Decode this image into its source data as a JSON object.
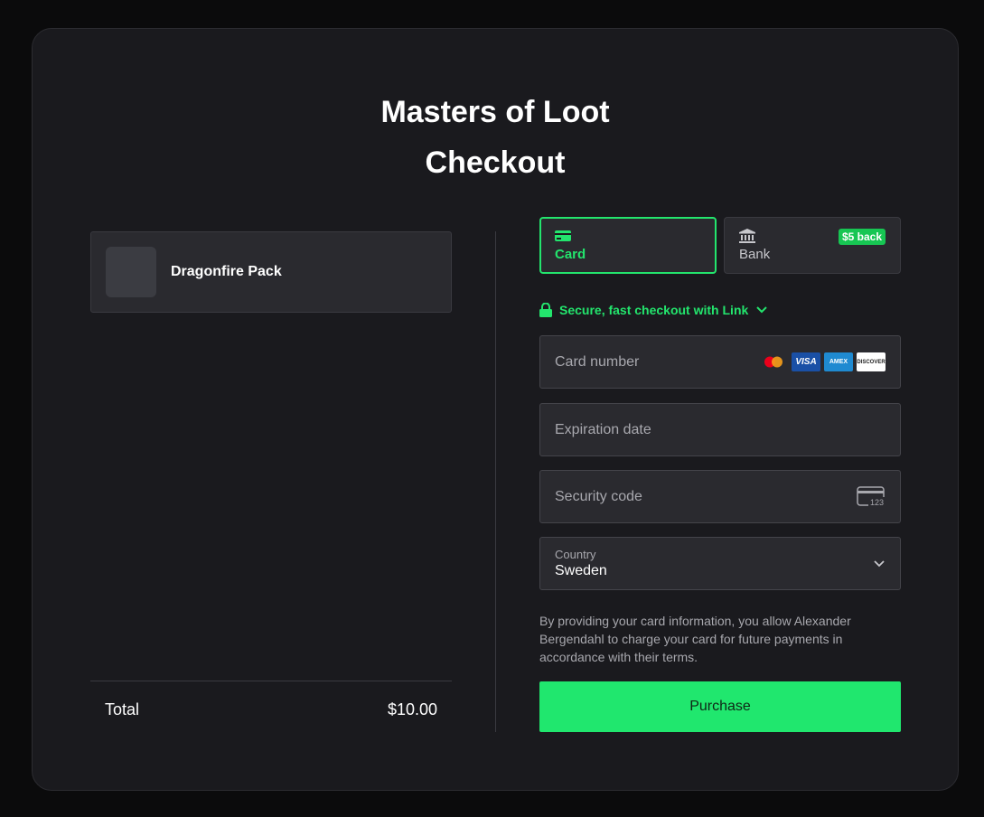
{
  "header": {
    "title_line1": "Masters of Loot",
    "title_line2": "Checkout"
  },
  "product": {
    "name": "Dragonfire Pack"
  },
  "summary": {
    "total_label": "Total",
    "total_value": "$10.00"
  },
  "payment_tabs": [
    {
      "label": "Card",
      "icon": "card-icon",
      "active": true
    },
    {
      "label": "Bank",
      "icon": "bank-icon",
      "badge": "$5 back",
      "active": false
    }
  ],
  "link": {
    "text": "Secure, fast checkout with Link",
    "icon": "lock-icon"
  },
  "fields": {
    "card_number_placeholder": "Card number",
    "card_brands": [
      "mastercard",
      "visa",
      "amex",
      "discover"
    ],
    "visa_text": "VISA",
    "amex_text": "AMEX",
    "discover_text": "DISCOVER",
    "expiry_placeholder": "Expiration date",
    "cvc_placeholder": "Security code",
    "cvc_icon_text": "123",
    "country_label": "Country",
    "country_value": "Sweden"
  },
  "terms": "By providing your card information, you allow Alexander Bergendahl to charge your card for future payments in accordance with their terms.",
  "purchase_label": "Purchase",
  "colors": {
    "accent": "#23e56d",
    "button": "#20e76e",
    "background": "#1a1a1e",
    "badge": "#17c653"
  }
}
